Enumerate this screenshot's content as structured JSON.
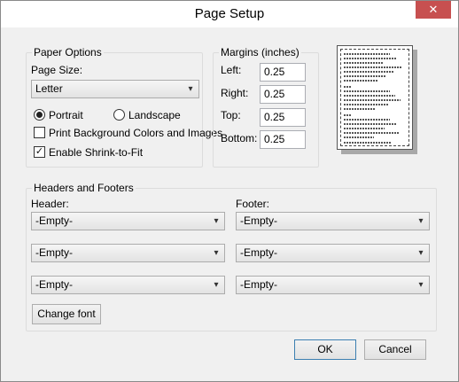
{
  "window": {
    "title": "Page Setup",
    "close_glyph": "✕"
  },
  "paper": {
    "group_label": "Paper Options",
    "size_label": "Page Size:",
    "size_value": "Letter",
    "portrait_label": "Portrait",
    "landscape_label": "Landscape",
    "orientation_selected": "Portrait",
    "print_bg_label": "Print Background Colors and Images",
    "print_bg_checked": false,
    "shrink_label": "Enable Shrink-to-Fit",
    "shrink_checked": true,
    "check_glyph": "✓"
  },
  "margins": {
    "group_label": "Margins (inches)",
    "left_label": "Left:",
    "left_value": "0.25",
    "right_label": "Right:",
    "right_value": "0.25",
    "top_label": "Top:",
    "top_value": "0.25",
    "bottom_label": "Bottom:",
    "bottom_value": "0.25"
  },
  "headers_footers": {
    "group_label": "Headers and Footers",
    "header_label": "Header:",
    "footer_label": "Footer:",
    "header_values": [
      "-Empty-",
      "-Empty-",
      "-Empty-"
    ],
    "footer_values": [
      "-Empty-",
      "-Empty-",
      "-Empty-"
    ],
    "change_font_label": "Change font"
  },
  "buttons": {
    "ok_label": "OK",
    "cancel_label": "Cancel"
  },
  "icons": {
    "dropdown": "chevron-down-icon",
    "close": "close-icon"
  },
  "colors": {
    "close_button": "#c75050",
    "default_button_border": "#3c7fb1",
    "dialog_background": "#f0f0f0"
  }
}
